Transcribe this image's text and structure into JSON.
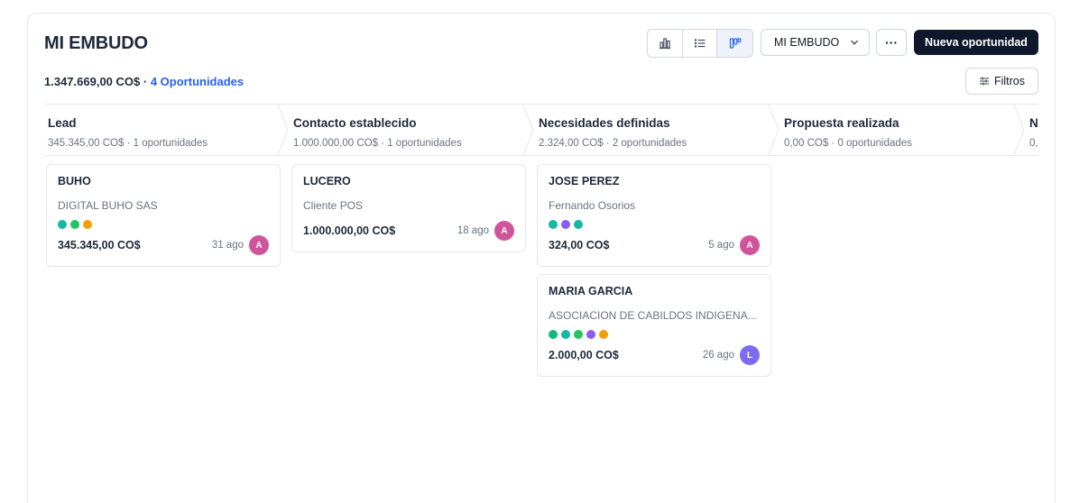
{
  "header": {
    "title": "MI EMBUDO",
    "total": "1.347.669,00 CO$",
    "separator": "·",
    "opportunities_link": "4 Oportunidades"
  },
  "toolbar": {
    "views": [
      {
        "icon": "bar-chart-icon",
        "active": false
      },
      {
        "icon": "list-icon",
        "active": false
      },
      {
        "icon": "kanban-icon",
        "active": true
      }
    ],
    "funnel_select": "MI EMBUDO",
    "more_label": "···",
    "new_opportunity_label": "Nueva oportunidad",
    "filters_label": "Filtros"
  },
  "stages": [
    {
      "name": "Lead",
      "info": "345.345,00 CO$ · 1 oportunidades"
    },
    {
      "name": "Contacto establecido",
      "info": "1.000.000,00 CO$ · 1 oportunidades"
    },
    {
      "name": "Necesidades definidas",
      "info": "2.324,00 CO$ · 2 oportunidades"
    },
    {
      "name": "Propuesta realizada",
      "info": "0,00 CO$ · 0 oportunidades"
    },
    {
      "name": "N",
      "info": "0,"
    }
  ],
  "cards": [
    {
      "stage": 0,
      "name": "BUHO",
      "subtitle": "DIGITAL BUHO SAS",
      "dots": [
        "#14b8a6",
        "#22c55e",
        "#f59e0b"
      ],
      "amount": "345.345,00 CO$",
      "age": "31 ago",
      "avatar": "A",
      "avatar_color": "#d0549b"
    },
    {
      "stage": 1,
      "name": "LUCERO",
      "subtitle": "Cliente POS",
      "dots": [],
      "amount": "1.000.000,00 CO$",
      "age": "18 ago",
      "avatar": "A",
      "avatar_color": "#d0549b"
    },
    {
      "stage": 2,
      "name": "JOSE PEREZ",
      "subtitle": "Fernando Osorios",
      "dots": [
        "#14b8a6",
        "#8b5cf6",
        "#14b8a6"
      ],
      "amount": "324,00 CO$",
      "age": "5 ago",
      "avatar": "A",
      "avatar_color": "#d0549b"
    },
    {
      "stage": 2,
      "name": "MARIA GARCIA",
      "subtitle": "ASOCIACION DE CABILDOS INDIGENA...",
      "dots": [
        "#10b981",
        "#14b8a6",
        "#22c55e",
        "#8b5cf6",
        "#f59e0b"
      ],
      "amount": "2.000,00 CO$",
      "age": "26 ago",
      "avatar": "L",
      "avatar_color": "#7c6cf0"
    }
  ]
}
